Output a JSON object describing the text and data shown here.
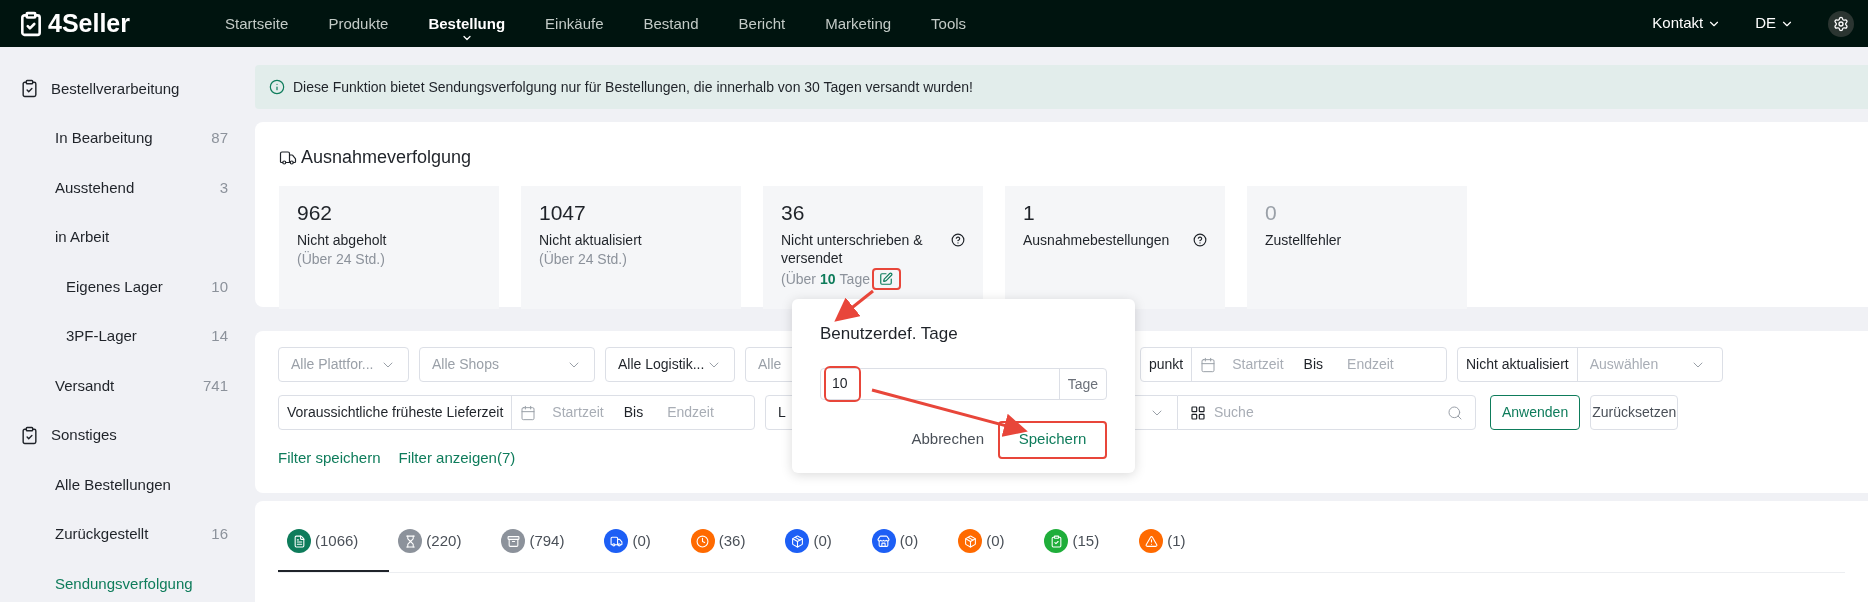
{
  "topbar": {
    "logo": "4Seller",
    "nav": [
      {
        "label": "Startseite",
        "selected": false
      },
      {
        "label": "Produkte",
        "selected": false
      },
      {
        "label": "Bestellung",
        "selected": true
      },
      {
        "label": "Einkäufe",
        "selected": false
      },
      {
        "label": "Bestand",
        "selected": false
      },
      {
        "label": "Bericht",
        "selected": false
      },
      {
        "label": "Marketing",
        "selected": false
      },
      {
        "label": "Tools",
        "selected": false
      }
    ],
    "contact": "Kontakt",
    "language": "DE"
  },
  "sidebar": {
    "groups": [
      {
        "title": "Bestellverarbeitung",
        "items": [
          {
            "label": "In Bearbeitung",
            "count": "87",
            "selected": false
          },
          {
            "label": "Ausstehend",
            "count": "3",
            "selected": false
          },
          {
            "label": "in Arbeit",
            "selected": false,
            "children": [
              {
                "label": "Eigenes Lager",
                "count": "10",
                "selected": false
              },
              {
                "label": "3PF-Lager",
                "count": "14",
                "selected": false
              }
            ]
          },
          {
            "label": "Versandt",
            "count": "741",
            "selected": false
          }
        ]
      },
      {
        "title": "Sonstiges",
        "items": [
          {
            "label": "Alle Bestellungen",
            "selected": false
          },
          {
            "label": "Zurückgestellt",
            "count": "16",
            "selected": false
          },
          {
            "label": "Sendungsverfolgung",
            "selected": true
          }
        ]
      }
    ]
  },
  "banner": "Diese Funktion bietet Sendungsverfolgung nur für Bestellungen, die innerhalb von 30 Tagen versandt wurden!",
  "exceptions": {
    "title": "Ausnahmeverfolgung",
    "cards": [
      {
        "value": "962",
        "label": "Nicht abgeholt",
        "note": "(Über 24 Std.)",
        "help": false,
        "muted": false
      },
      {
        "value": "1047",
        "label": "Nicht aktualisiert",
        "note": "(Über 24 Std.)",
        "help": false,
        "muted": false
      },
      {
        "value": "36",
        "label": "Nicht unterschrieben & versendet",
        "note": "(Über",
        "days": "10",
        "unit": "Tage",
        "help": true,
        "muted": false,
        "editable": true
      },
      {
        "value": "1",
        "label": "Ausnahmebestellungen",
        "help": true,
        "muted": false
      },
      {
        "value": "0",
        "label": "Zustellfehler",
        "help": false,
        "muted": true
      }
    ]
  },
  "filters": {
    "row_1": [
      {
        "kind": "select",
        "text": "Alle Plattfor...",
        "placeholder": true
      },
      {
        "kind": "select",
        "text": "Alle Shops",
        "placeholder": true
      },
      {
        "kind": "select",
        "text": "Alle Logistik...",
        "placeholder": false
      },
      {
        "kind": "select",
        "text": "Alle",
        "placeholder": true
      },
      {
        "kind": "daterange",
        "label": "punkt",
        "start": "Startzeit",
        "to": "Bis",
        "end": "Endzeit"
      },
      {
        "kind": "labeled_select",
        "label": "Nicht aktualisiert",
        "text": "Auswählen"
      }
    ],
    "row_2": [
      {
        "kind": "daterange",
        "label": "Voraussichtliche früheste Lieferzeit",
        "start": "Startzeit",
        "to": "Bis",
        "end": "Endzeit"
      },
      {
        "kind": "select",
        "text": "L",
        "placeholder": false
      },
      {
        "kind": "search",
        "placeholder": "Suche"
      }
    ],
    "apply": "Anwenden",
    "reset": "Zurücksetzen",
    "save_filter": "Filter speichern",
    "show_filter": "Filter anzeigen(7)"
  },
  "popup": {
    "title": "Benutzerdef. Tage",
    "value": "10",
    "unit": "Tage",
    "cancel": "Abbrechen",
    "save": "Speichern"
  },
  "tabs": [
    {
      "count": "(1066)",
      "color": "#0e7c5b",
      "selected": true
    },
    {
      "count": "(220)",
      "color": "#8c929b",
      "selected": false
    },
    {
      "count": "(794)",
      "color": "#8c929b",
      "selected": false
    },
    {
      "count": "(0)",
      "color": "#1d5ff5",
      "selected": false
    },
    {
      "count": "(36)",
      "color": "#ff6a00",
      "selected": false
    },
    {
      "count": "(0)",
      "color": "#1d5ff5",
      "selected": false
    },
    {
      "count": "(0)",
      "color": "#1d5ff5",
      "selected": false
    },
    {
      "count": "(0)",
      "color": "#ff6a00",
      "selected": false
    },
    {
      "count": "(15)",
      "color": "#1fae3a",
      "selected": false
    },
    {
      "count": "(1)",
      "color": "#ff6a00",
      "selected": false
    }
  ]
}
